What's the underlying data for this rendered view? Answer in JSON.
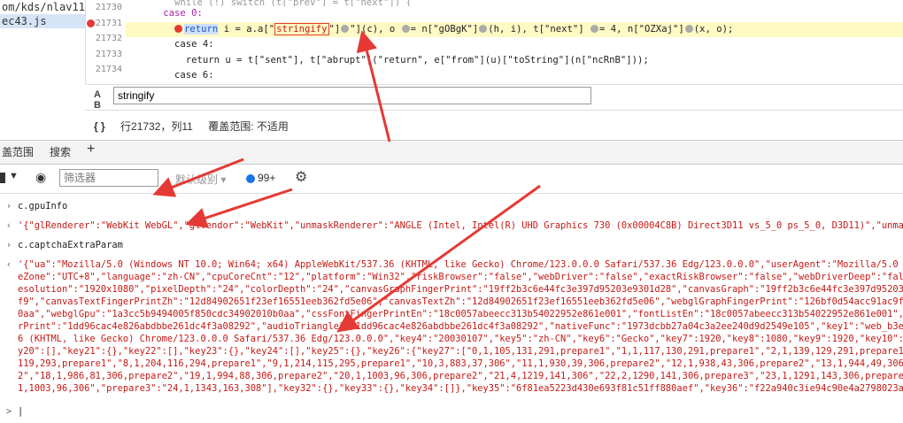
{
  "file_tree": [
    "om/kds/nlav1168",
    "ec43.js"
  ],
  "gutter_lines": [
    "21730",
    "21731",
    "21732",
    "21733",
    "21734"
  ],
  "code": {
    "line0": "        while (!) switch (t[\"prev\"] = t[\"next\"]) {",
    "line1_case": "case 0:",
    "line2_a": "return",
    "line2_b": " i = a.a[\"",
    "line2_boxed": "stringify",
    "line2_c": "\"](c), o ",
    "line2_d": "= n[\"gOBgK\"]",
    "line2_e": "(h, i), t[\"next\"] ",
    "line2_f": "= 4, n[\"OZXaj\"]",
    "line2_g": "(x, o);",
    "line3": "        case 4:",
    "line4": "          return u = t[\"sent\"], t[\"abrupt\"](\"return\", e[\"from\"](u)[\"toString\"](n[\"ncRnB\"]));",
    "line5": "        case 6:"
  },
  "search": {
    "icon": "A B",
    "value": "stringify"
  },
  "status": {
    "braces": "{ }",
    "position": "行21732，列11",
    "coverage": "覆盖范围: 不适用"
  },
  "tabs": [
    "盖范围",
    "搜索",
    "+"
  ],
  "toolbar": {
    "filter_placeholder": "筛选器",
    "levels": "默认级别 ▾",
    "issues": "99+"
  },
  "console": {
    "cmd1": "c.gpuInfo",
    "res1": "'{\"glRenderer\":\"WebKit WebGL\",\"glVendor\":\"WebKit\",\"unmaskRenderer\":\"ANGLE (Intel, Intel(R) UHD Graphics 730 (0x00004C8B) Direct3D11 vs_5_0 ps_5_0, D3D11)\",\"unmaskVend",
    "cmd2": "c.captchaExtraParam",
    "lines": [
      "'{\"ua\":\"Mozilla/5.0 (Windows NT 10.0; Win64; x64) AppleWebKit/537.36 (KHTML, like Gecko) Chrome/123.0.0.0 Safari/537.36 Edg/123.0.0.0\",\"userAgent\":\"Mozilla/5.0 (Windo",
      "eZone\":\"UTC+8\",\"language\":\"zh-CN\",\"cpuCoreCnt\":\"12\",\"platform\":\"Win32\",\"riskBrowser\":\"false\",\"webDriver\":\"false\",\"exactRiskBrowser\":\"false\",\"webDriverDeep\":\"false\",",
      "esolution\":\"1920x1080\",\"pixelDepth\":\"24\",\"colorDepth\":\"24\",\"canvasGraphFingerPrint\":\"19ff2b3c6e44fc3e397d95203e9301d28\",\"canvasGraph\":\"19ff2b3c6e44fc3e397d95203e9301d",
      "f9\",\"canvasTextFingerPrintZh\":\"12d84902651f23ef16551eeb362fd5e06\",\"canvasTextZh\":\"12d84902651f23ef16551eeb362fd5e06\",\"webglGraphFingerPrint\":\"126bf0d54acc91ac9ff6b278",
      "0aa\",\"webglGpu\":\"1a3cc5b9494005f850cdc34902010b0aa\",\"cssFontFingerPrintEn\":\"18c0057abeecc313b54022952e861e001\",\"fontListEn\":\"18c0057abeecc313b54022952e861e001\",\"cssFo",
      "rPrint\":\"1dd96cac4e826abdbbe261dc4f3a08292\",\"audioTriangle\":\"1dd96cac4e826abdbbe261dc4f3a08292\",\"nativeFunc\":\"1973dcbb27a04c3a2ee240d9d2549e105\",\"key1\":\"web_b3e9ff2f6",
      "6 (KHTML, like Gecko) Chrome/123.0.0.0 Safari/537.36 Edg/123.0.0.0\",\"key4\":\"20030107\",\"key5\":\"zh-CN\",\"key6\":\"Gecko\",\"key7\":1920,\"key8\":1080,\"key9\":1920,\"key10\":1032,\"",
      "y20\":[],\"key21\":{},\"key22\":[],\"key23\":{},\"key24\":[],\"key25\":{},\"key26\":{\"key27\":[\"0,1,105,131,291,prepare1\",\"1,1,117,130,291,prepare1\",\"2,1,139,129,291,prepare1\",\"3,1",
      "119,293,prepare1\",\"8,1,204,116,294,prepare1\",\"9,1,214,115,295,prepare1\",\"10,3,883,37,306\",\"11,1,930,39,306,prepare2\",\"12,1,938,43,306,prepare2\",\"13,1,944,49,306,prepa",
      "2\",\"18,1,986,81,306,prepare2\",\"19,1,994,88,306,prepare2\",\"20,1,1003,96,306,prepare2\",\"21,4,1219,141,306\",\"22,2,1290,141,306,prepare3\",\"23,1,1291,143,306,prepare3\",\"24",
      "1,1003,96,306\",\"prepare3\":\"24,1,1343,163,308\"],\"key32\":{},\"key33\":{},\"key34\":[]},\"key35\":\"6f81ea5223d430e693f81c51ff880aef\",\"key36\":\"f22a940c3ie94c90e4a2798023a1985\""
    ],
    "prompt": ">"
  }
}
